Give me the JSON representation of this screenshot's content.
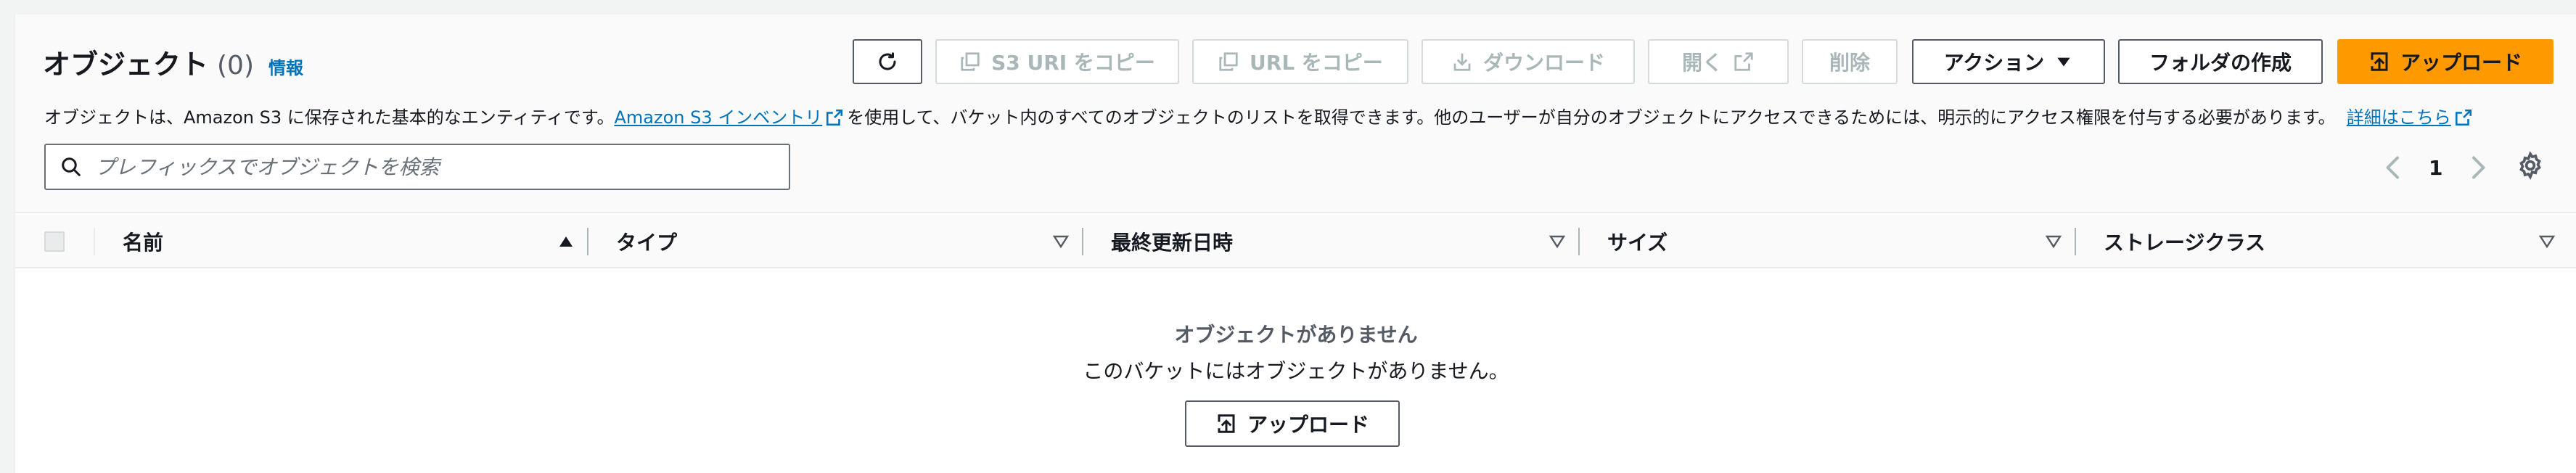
{
  "header": {
    "title": "オブジェクト",
    "count": "(0)",
    "info": "情報"
  },
  "description": {
    "before": "オブジェクトは、Amazon S3 に保存された基本的なエンティティです。",
    "inventory_link": "Amazon S3 インベントリ",
    "middle": "を使用して、バケット内のすべてのオブジェクトのリストを取得できます。他のユーザーが自分のオブジェクトにアクセスできるためには、明示的にアクセス権限を付与する必要があります。",
    "details_link": "詳細はこちら"
  },
  "toolbar": {
    "copy_s3_uri": "S3 URI をコピー",
    "copy_url": "URL をコピー",
    "download": "ダウンロード",
    "open": "開く",
    "delete": "削除",
    "actions": "アクション",
    "create_folder": "フォルダの作成",
    "upload": "アップロード"
  },
  "search": {
    "placeholder": "プレフィックスでオブジェクトを検索"
  },
  "pagination": {
    "current_page": "1"
  },
  "table": {
    "columns": [
      "名前",
      "タイプ",
      "最終更新日時",
      "サイズ",
      "ストレージクラス"
    ]
  },
  "empty_state": {
    "title": "オブジェクトがありません",
    "message": "このバケットにはオブジェクトがありません。",
    "upload_button": "アップロード"
  },
  "colors": {
    "primary": "#ff9900",
    "link": "#0073bb",
    "text": "#16191f",
    "disabled": "#aab7b8"
  }
}
